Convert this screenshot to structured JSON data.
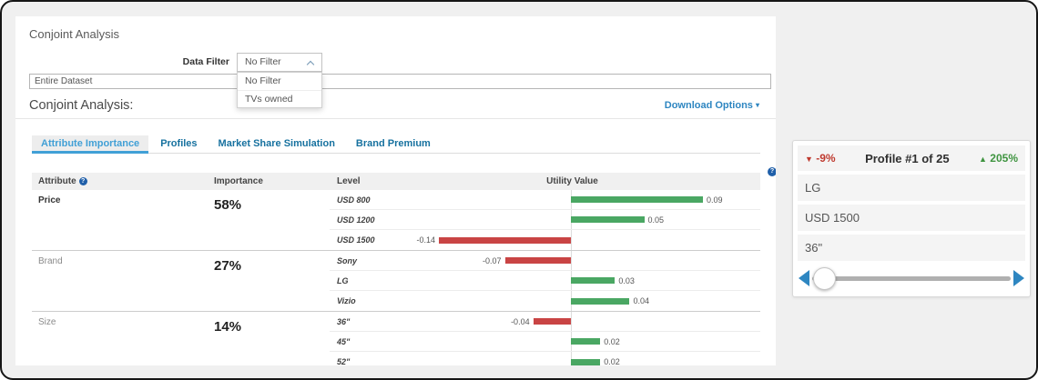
{
  "app": {
    "title": "Conjoint Analysis",
    "section_title": "Conjoint Analysis:",
    "download_options_label": "Download Options",
    "data_filter": {
      "label": "Data Filter",
      "selected": "No Filter",
      "options": [
        "No Filter",
        "TVs owned"
      ]
    },
    "dataset_field": {
      "value": "Entire Dataset"
    }
  },
  "tabs": [
    {
      "label": "Attribute Importance",
      "active": true
    },
    {
      "label": "Profiles",
      "active": false
    },
    {
      "label": "Market Share Simulation",
      "active": false
    },
    {
      "label": "Brand Premium",
      "active": false
    }
  ],
  "table": {
    "headers": [
      "Attribute",
      "Importance",
      "Level",
      "Utility Value"
    ],
    "groups": [
      {
        "attribute": "Price",
        "importance": "58%",
        "emphasis": true,
        "levels": [
          {
            "label": "USD 800",
            "value": 0.09
          },
          {
            "label": "USD 1200",
            "value": 0.05
          },
          {
            "label": "USD 1500",
            "value": -0.14
          }
        ]
      },
      {
        "attribute": "Brand",
        "importance": "27%",
        "emphasis": false,
        "levels": [
          {
            "label": "Sony",
            "value": -0.07
          },
          {
            "label": "LG",
            "value": 0.03
          },
          {
            "label": "Vizio",
            "value": 0.04
          }
        ]
      },
      {
        "attribute": "Size",
        "importance": "14%",
        "emphasis": false,
        "levels": [
          {
            "label": "36\"",
            "value": -0.04
          },
          {
            "label": "45\"",
            "value": 0.02
          },
          {
            "label": "52\"",
            "value": 0.02
          }
        ]
      }
    ]
  },
  "chart_data": {
    "type": "bar",
    "title": "Utility Value",
    "categories": [
      "USD 800",
      "USD 1200",
      "USD 1500",
      "Sony",
      "LG",
      "Vizio",
      "36\"",
      "45\"",
      "52\""
    ],
    "values": [
      0.09,
      0.05,
      -0.14,
      -0.07,
      0.03,
      0.04,
      -0.04,
      0.02,
      0.02
    ],
    "orientation": "horizontal",
    "positive_color": "#4aa763",
    "negative_color": "#c94444"
  },
  "profile_panel": {
    "decrease": "-9%",
    "down_marker": "▼",
    "title": "Profile #1 of 25",
    "increase": "205%",
    "up_marker": "▲",
    "items": [
      "LG",
      "USD 1500",
      "36\""
    ],
    "slider_value_pct": 3
  },
  "colors": {
    "positive_bar": "#4aa763",
    "negative_bar": "#c94444",
    "link_blue": "#2e86c1",
    "active_tab": "#41a0d6",
    "tab_blue": "#16719f",
    "decrease_text": "#bf3a2f",
    "increase_text": "#3f9440"
  }
}
